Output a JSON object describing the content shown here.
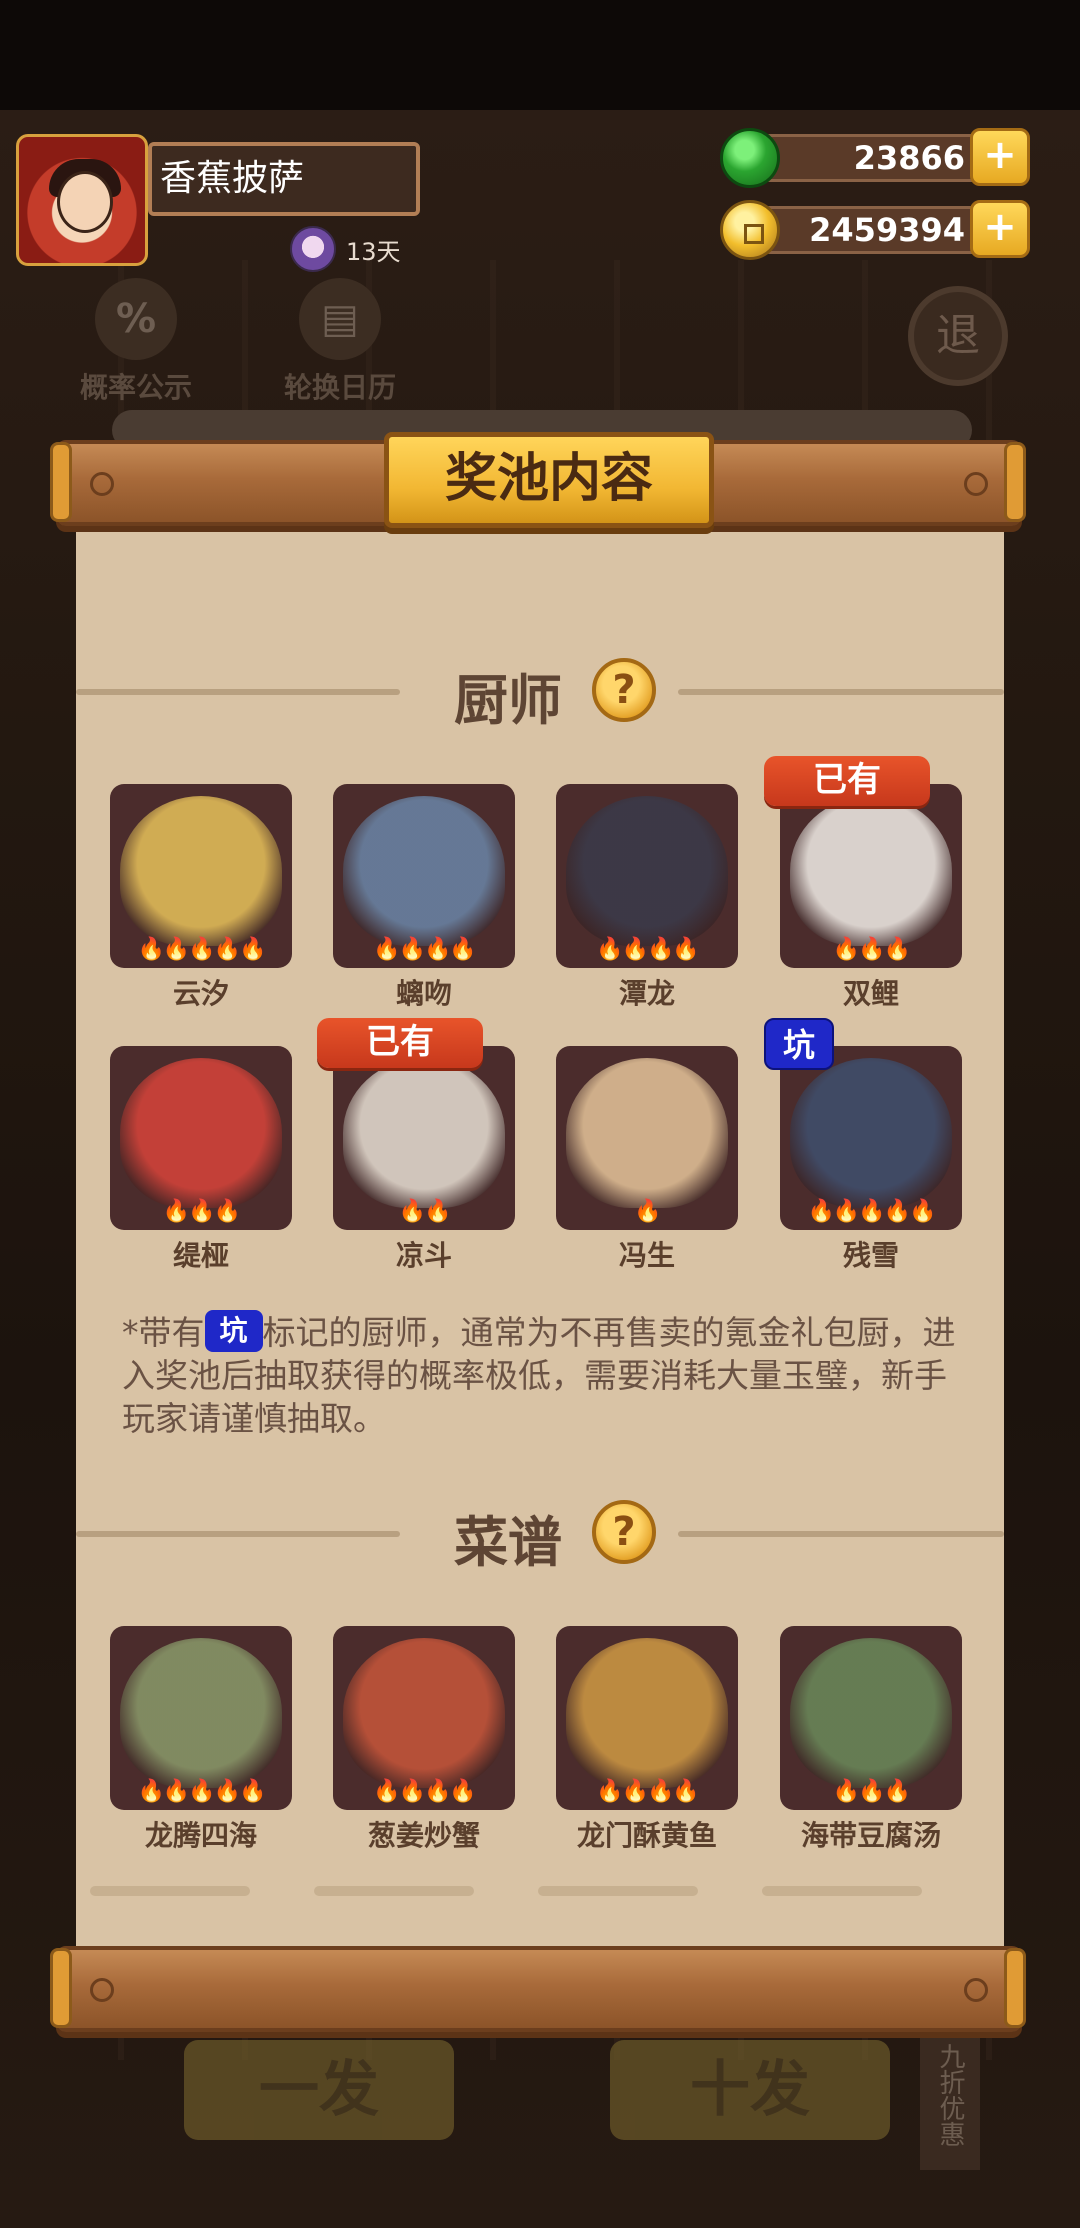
{
  "player": {
    "name": "香蕉披萨",
    "days": "13天"
  },
  "currency": {
    "jade": "23866",
    "gold": "2459394",
    "plus": "+"
  },
  "background": {
    "prob_label": "概率公示",
    "calendar_label": "轮换日历",
    "exit_label": "退",
    "single_pull": "一发",
    "ten_pull": "十发",
    "discount": "九折优惠",
    "percent_icon": "%",
    "calendar_icon": "▤"
  },
  "panel": {
    "title": "奖池内容",
    "chef_section": {
      "label": "厨师",
      "help": "?"
    },
    "chefs": [
      {
        "name": "云汐",
        "stars": 5,
        "tag": "",
        "color": "#e8c25a"
      },
      {
        "name": "螭吻",
        "stars": 4,
        "tag": "",
        "color": "#6a86a8"
      },
      {
        "name": "潭龙",
        "stars": 4,
        "tag": "",
        "color": "#3a3a4a"
      },
      {
        "name": "双鲤",
        "stars": 3,
        "tag": "已有",
        "color": "#f2eee8"
      },
      {
        "name": "缇桠",
        "stars": 3,
        "tag": "",
        "color": "#d8443a"
      },
      {
        "name": "凉斗",
        "stars": 2,
        "tag": "已有",
        "color": "#e8e0d4"
      },
      {
        "name": "冯生",
        "stars": 1,
        "tag": "",
        "color": "#e6c59a"
      },
      {
        "name": "残雪",
        "stars": 5,
        "tag": "坑",
        "color": "#3e4f6e"
      }
    ],
    "note": {
      "prefix": "*带有",
      "pit": "坑",
      "suffix": "标记的厨师，通常为不再售卖的氪金礼包厨，进入奖池后抽取获得的概率极低，需要消耗大量玉璧，新手玩家请谨慎抽取。"
    },
    "recipe_section": {
      "label": "菜谱",
      "help": "?"
    },
    "recipes": [
      {
        "name": "龙腾四海",
        "stars": 5,
        "color": "#8a9a6a"
      },
      {
        "name": "葱姜炒蟹",
        "stars": 4,
        "color": "#c8563a"
      },
      {
        "name": "龙门酥黄鱼",
        "stars": 4,
        "color": "#d09a44"
      },
      {
        "name": "海带豆腐汤",
        "stars": 3,
        "color": "#6a8a5a"
      }
    ],
    "star_glyph": "🔥"
  }
}
